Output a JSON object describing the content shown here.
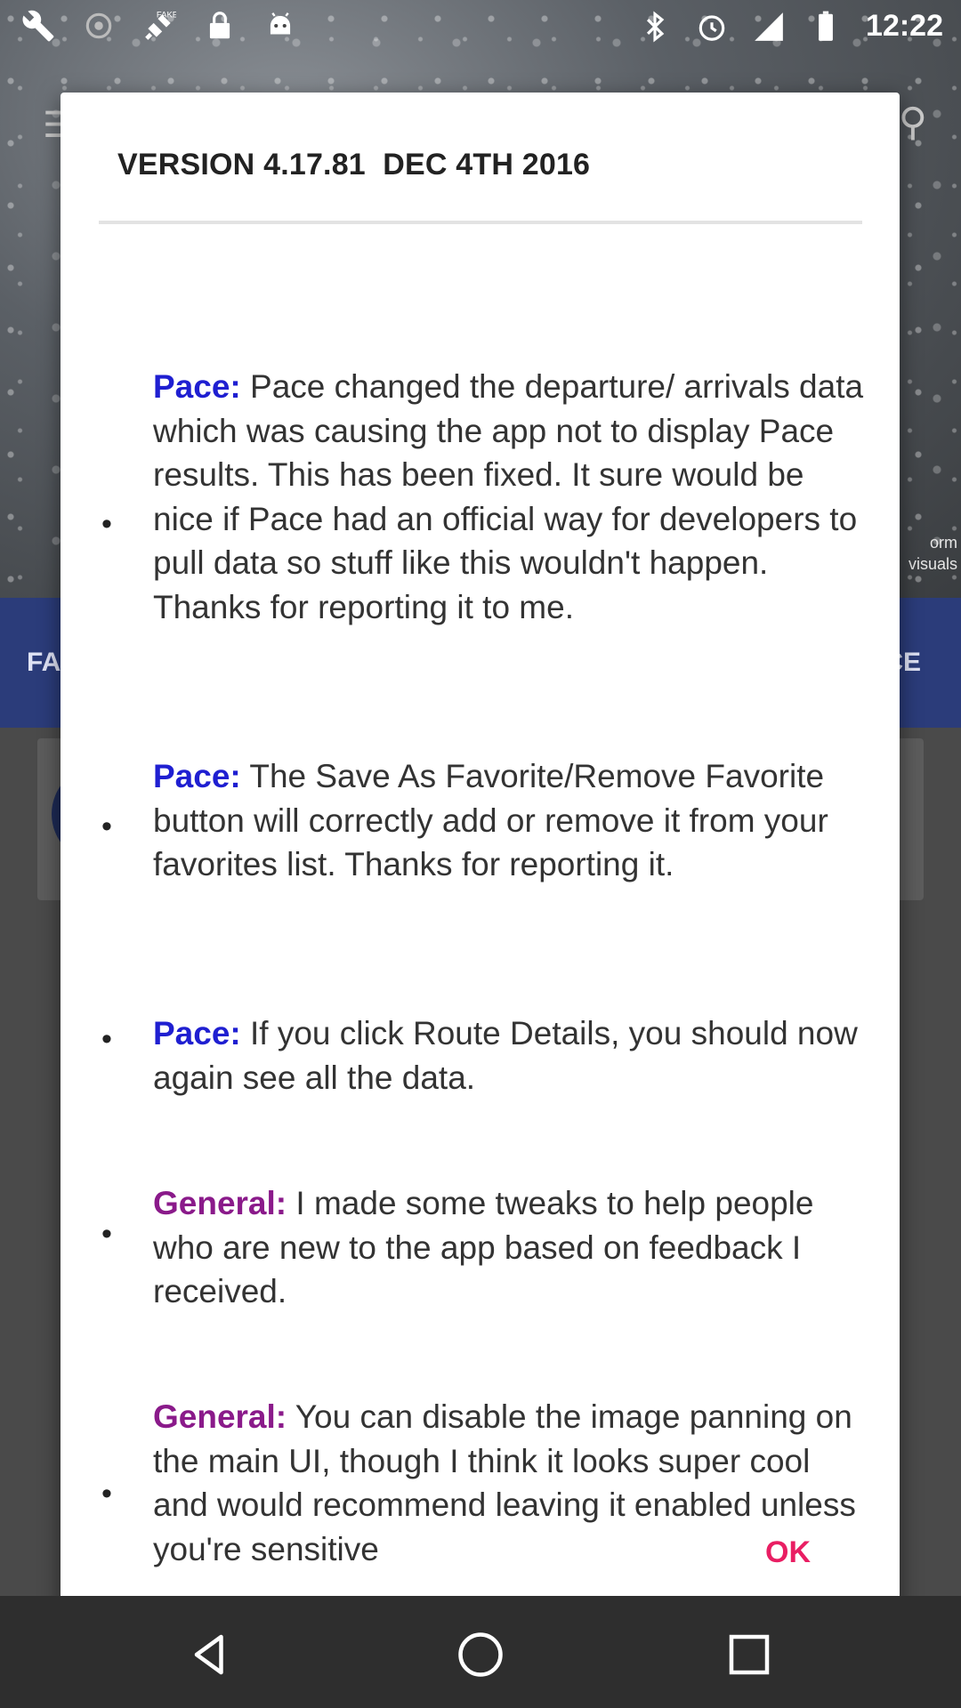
{
  "status_bar": {
    "time": "12:22",
    "icons_left": [
      "wrench-icon",
      "gps-icon",
      "fake-gps-icon",
      "lock-icon",
      "android-icon"
    ],
    "icons_right": [
      "bluetooth-icon",
      "alarm-icon",
      "signal-icon",
      "battery-icon"
    ]
  },
  "background": {
    "tab_left": "FA",
    "tab_right": "CE",
    "photo_caption": "orm\nvisuals"
  },
  "dialog": {
    "title": "VERSION 4.17.81  DEC 4TH 2016",
    "notes": [
      {
        "tag": "Pace:",
        "type": "pace",
        "text": " Pace changed the departure/ arrivals data which was causing the app not to display Pace results. This has been fixed. It sure would be nice if Pace had an official way for developers to pull data so stuff like this wouldn't happen. Thanks for reporting it to me."
      },
      {
        "tag": "Pace:",
        "type": "pace",
        "text": " The Save As Favorite/Remove Favorite button will correctly add or remove it from your favorites list. Thanks for reporting it."
      },
      {
        "tag": "Pace:",
        "type": "pace",
        "text": " If you click Route Details, you should now again see all the data."
      },
      {
        "tag": "General:",
        "type": "general",
        "text": " I made some tweaks to help people who are new to the app based on feedback I received."
      },
      {
        "tag": "General:",
        "type": "general",
        "text": " You can disable the image panning on the main UI, though I think it looks super cool and would recommend leaving it enabled unless you're sensitive"
      }
    ],
    "ok_label": "OK"
  },
  "colors": {
    "pace_tag": "#1f1fd1",
    "general_tag": "#8a1a8a",
    "ok_button": "#e91e63"
  }
}
